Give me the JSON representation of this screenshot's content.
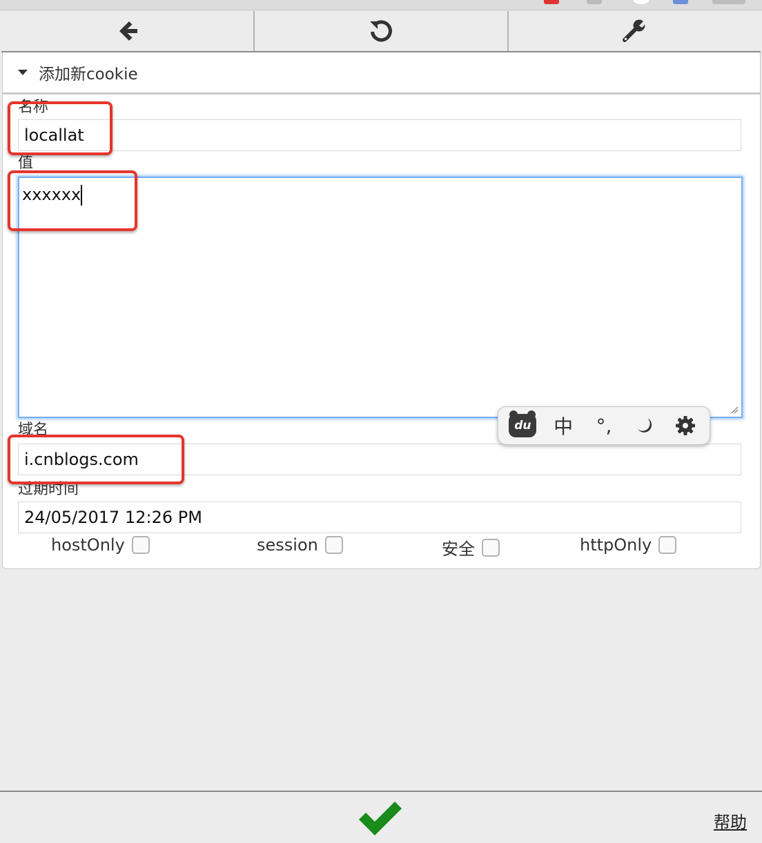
{
  "toolbar": {
    "back_icon": "arrow-left-icon",
    "refresh_icon": "refresh-icon",
    "settings_icon": "wrench-icon"
  },
  "panel": {
    "title": "添加新cookie"
  },
  "form": {
    "name_label": "名称",
    "name_value": "locallat",
    "value_label": "值",
    "value_value": "xxxxxx",
    "domain_label": "域名",
    "domain_value": "i.cnblogs.com",
    "expires_label": "过期时间",
    "expires_value": "24/05/2017 12:26 PM"
  },
  "checkboxes": [
    {
      "label": "hostOnly",
      "checked": false
    },
    {
      "label": "session",
      "checked": false
    },
    {
      "label": "安全",
      "checked": false
    },
    {
      "label": "httpOnly",
      "checked": false
    }
  ],
  "ime": {
    "logo": "du",
    "mode": "中",
    "punct": "°,",
    "theme_icon": "moon-icon",
    "settings_icon": "gear-icon"
  },
  "footer": {
    "confirm_icon": "checkmark-icon",
    "help": "帮助"
  },
  "colors": {
    "highlight": "#e5352b",
    "focus": "#79aef2",
    "confirm": "#1a8a1a"
  }
}
